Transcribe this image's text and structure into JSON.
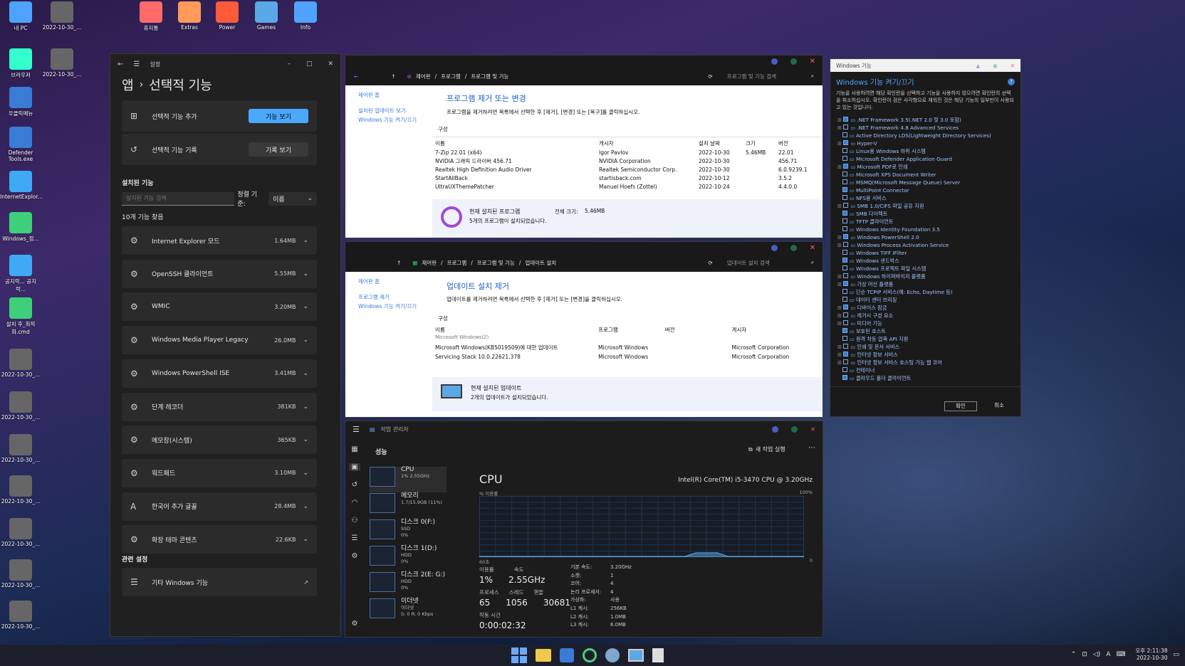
{
  "desktop": {
    "icons": [
      "내 PC",
      "2022-10-30_...",
      "휴지통",
      "Extras",
      "Power",
      "Games",
      "Info",
      "브라우저",
      "2022-10-30_...",
      "우클릭메뉴",
      "Defender Tools.exe",
      "InternetExplor...",
      "Windows_정...",
      "공지락... 공지락...",
      "설치 후_최적화.cmd",
      "2022-10-30_...",
      "2022-10-30_...",
      "2022-10-30_...",
      "2022-10-30_...",
      "2022-10-30_...",
      "2022-10-30_...",
      "2022-10-30_..."
    ]
  },
  "settings": {
    "window_title": "설정",
    "breadcrumb_root": "앱",
    "breadcrumb_sep": "›",
    "page_title": "선택적 기능",
    "add_feature_label": "선택적 기능 추가",
    "add_feature_button": "기능 보기",
    "history_label": "선택적 기능 기록",
    "history_button": "기록 보기",
    "installed_heading": "설치된 기능",
    "search_placeholder": "설치된 기능 검색",
    "sort_label": "정렬 기준:",
    "sort_value": "이름",
    "found_count": "10개 기능 찾음",
    "features": [
      {
        "name": "Internet Explorer 모드",
        "size": "1.64MB"
      },
      {
        "name": "OpenSSH 클라이언트",
        "size": "5.55MB"
      },
      {
        "name": "WMIC",
        "size": "3.20MB"
      },
      {
        "name": "Windows Media Player Legacy",
        "size": "26.0MB"
      },
      {
        "name": "Windows PowerShell ISE",
        "size": "3.41MB"
      },
      {
        "name": "단계 레코더",
        "size": "381KB"
      },
      {
        "name": "메모장(시스템)",
        "size": "365KB"
      },
      {
        "name": "워드패드",
        "size": "3.10MB"
      },
      {
        "name": "한국어 추가 글꼴",
        "size": "28.4MB"
      },
      {
        "name": "확장 테마 콘텐츠",
        "size": "22.6KB"
      }
    ],
    "related_heading": "관련 설정",
    "related_item": "기타 Windows 기능"
  },
  "programs": {
    "breadcrumb": [
      "제어판",
      "프로그램",
      "프로그램 및 기능"
    ],
    "search_placeholder": "프로그램 및 기능 검색",
    "side_links": [
      "제어판 홈",
      "설치된 업데이트 보기",
      "Windows 기능 켜기/끄기"
    ],
    "title": "프로그램 제거 또는 변경",
    "desc": "프로그램을 제거하려면 목록에서 선택한 후 [제거], [변경] 또는 [복구]를 클릭하십시오.",
    "organize": "구성",
    "columns": [
      "이름",
      "게시자",
      "설치 날짜",
      "크기",
      "버전"
    ],
    "rows": [
      [
        "7-Zip 22.01 (x64)",
        "Igor Pavlov",
        "2022-10-30",
        "5.46MB",
        "22.01"
      ],
      [
        "NVIDIA 그래픽 드라이버 456.71",
        "NVIDIA Corporation",
        "2022-10-30",
        "",
        "456.71"
      ],
      [
        "Realtek High Definition Audio Driver",
        "Realtek Semiconductor Corp.",
        "2022-10-30",
        "",
        "6.0.9239.1"
      ],
      [
        "StartAllBack",
        "startisback.com",
        "2022-10-12",
        "",
        "3.5.2"
      ],
      [
        "UltraUXThemePatcher",
        "Manuel Hoefs (Zottel)",
        "2022-10-24",
        "",
        "4.4.0.0"
      ]
    ],
    "footer_title": "현재 설치된 프로그램",
    "footer_total_label": "전체 크기:",
    "footer_total": "5.46MB",
    "footer_count": "5개의 프로그램이 설치되었습니다."
  },
  "updates": {
    "breadcrumb": [
      "제어판",
      "프로그램",
      "프로그램 및 기능",
      "업데이트 설치"
    ],
    "search_placeholder": "업데이트 설치 검색",
    "side_links": [
      "제어판 홈",
      "프로그램 제거",
      "Windows 기능 켜기/끄기"
    ],
    "title": "업데이트 설치 제거",
    "desc": "업데이트를 제거하려면 목록에서 선택한 후 [제거] 또는 [변경]을 클릭하십시오.",
    "organize": "구성",
    "columns": [
      "이름",
      "프로그램",
      "버전",
      "게시자"
    ],
    "group": "Microsoft Windows(2)",
    "rows": [
      [
        "Microsoft Windows(KB5019509)에 대한 업데이트",
        "Microsoft Windows",
        "",
        "Microsoft Corporation"
      ],
      [
        "Servicing Stack 10.0.22621.378",
        "Microsoft Windows",
        "",
        "Microsoft Corporation"
      ]
    ],
    "footer_title": "현재 설치된 업데이트",
    "footer_count": "2개의 업데이트가 설치되었습니다."
  },
  "features_dialog": {
    "title": "Windows 기능",
    "heading": "Windows 기능 켜기/끄기",
    "desc": "기능을 사용하려면 해당 확인란을 선택하고 기능을 사용하지 않으려면 확인란의 선택을 취소하십시오. 확인란이 검은 사각형으로 채워진 것은 해당 기능의 일부만이 사용되고 있는 것입니다.",
    "items": [
      ".NET Framework 3.5(.NET 2.0 및 3.0 포함)",
      ".NET Framework 4.8 Advanced Services",
      "Active Directory LDS(Lightweight Directory Services)",
      "Hyper-V",
      "Linux용 Windows 하위 시스템",
      "Microsoft Defender Application Guard",
      "Microsoft PDF로 인쇄",
      "Microsoft XPS Document Writer",
      "MSMQ(Microsoft Message Queue) Server",
      "MultiPoint Connector",
      "NFS용 서비스",
      "SMB 1.0/CIFS 파일 공유 지원",
      "SMB 다이렉트",
      "TFTP 클라이언트",
      "Windows Identity Foundation 3.5",
      "Windows PowerShell 2.0",
      "Windows Process Activation Service",
      "Windows TIFF IFilter",
      "Windows 샌드박스",
      "Windows 프로젝트 파일 시스템",
      "Windows 하이퍼바이저 플랫폼",
      "가상 머신 플랫폼",
      "단순 TCPIP 서비스(예: Echo, Daytime 등)",
      "데이터 센터 브리징",
      "디바이스 잠금",
      "레거시 구성 요소",
      "미디어 기능",
      "보호된 호스트",
      "원격 차등 압축 API 지원",
      "인쇄 및 문서 서비스",
      "인터넷 정보 서비스",
      "인터넷 정보 서비스 호스팅 가능 웹 코어",
      "컨테이너",
      "클라우드 폴더 클라이언트"
    ],
    "ok": "확인",
    "cancel": "취소"
  },
  "taskmgr": {
    "title": "작업 관리자",
    "section": "성능",
    "new_task": "새 작업 실행",
    "side": [
      {
        "name": "CPU",
        "sub": "1% 2.55GHz"
      },
      {
        "name": "메모리",
        "sub": "1.7/15.9GB (11%)"
      },
      {
        "name": "디스크 0(F:)",
        "sub": "SSD",
        "val": "0%"
      },
      {
        "name": "디스크 1(D:)",
        "sub": "HDD",
        "val": "0%"
      },
      {
        "name": "디스크 2(E: G:)",
        "sub": "HDD",
        "val": "0%"
      },
      {
        "name": "이더넷",
        "sub": "이더넷",
        "val": "S: 0 R: 0 Kbps"
      }
    ],
    "cpu_title": "CPU",
    "cpu_model": "Intel(R) Core(TM) i5-3470 CPU @ 3.20GHz",
    "usage_label": "% 이용률",
    "max_label": "100%",
    "time_label": "60초",
    "min_label": "0",
    "util_label": "이용률",
    "util": "1%",
    "speed_label": "속도",
    "speed": "2.55GHz",
    "proc_label": "프로세스",
    "proc": "65",
    "thread_label": "스레드",
    "thread": "1056",
    "handle_label": "핸들",
    "handle": "30681",
    "uptime_label": "작동 시간",
    "uptime": "0:00:02:32",
    "specs": [
      [
        "기본 속도:",
        "3.20GHz"
      ],
      [
        "소켓:",
        "1"
      ],
      [
        "코어:",
        "4"
      ],
      [
        "논리 프로세서:",
        "4"
      ],
      [
        "가상화:",
        "사용"
      ],
      [
        "L1 캐시:",
        "256KB"
      ],
      [
        "L2 캐시:",
        "1.0MB"
      ],
      [
        "L3 캐시:",
        "6.0MB"
      ]
    ]
  },
  "chart_data": {
    "type": "area",
    "title": "CPU",
    "ylabel": "% 이용률",
    "ylim": [
      0,
      100
    ],
    "x": [
      0,
      2,
      4,
      6,
      8,
      10,
      12,
      14,
      16,
      18,
      20,
      22,
      24,
      26,
      28,
      30,
      32,
      34,
      36,
      38,
      40,
      42,
      44,
      46,
      48,
      50,
      52,
      54,
      56,
      58,
      60
    ],
    "values": [
      0,
      0,
      0,
      0,
      0,
      0,
      0,
      0,
      0,
      0,
      0,
      0,
      0,
      0,
      0,
      0,
      0,
      0,
      0,
      0,
      1,
      1,
      1,
      0,
      0,
      0,
      0,
      0,
      0,
      0,
      0
    ]
  },
  "taskbar": {
    "time": "오후 2:11:38",
    "date": "2022-10-30",
    "lang": "A"
  }
}
